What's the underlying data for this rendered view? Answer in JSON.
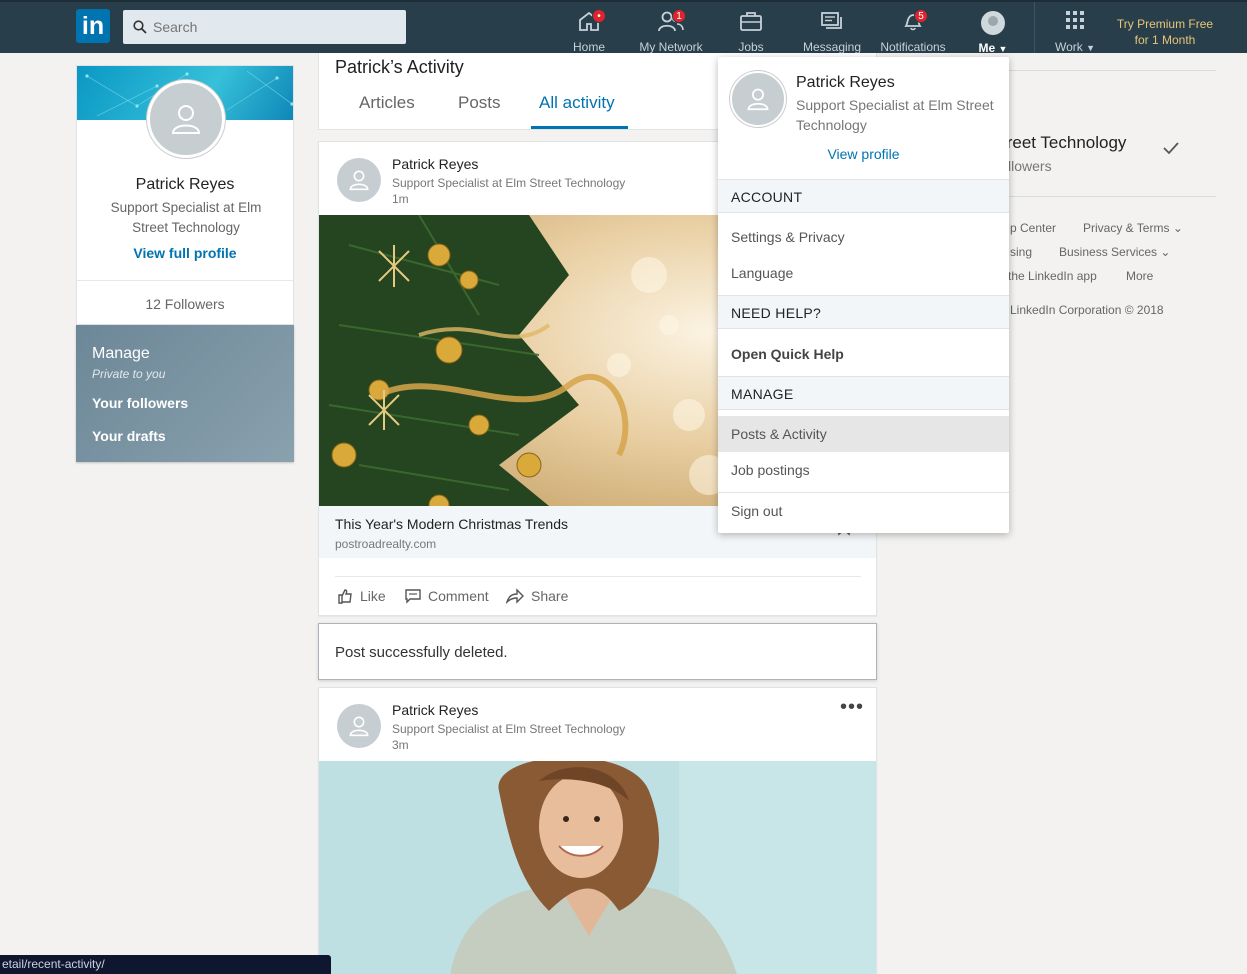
{
  "nav": {
    "logo_text": "in",
    "search_placeholder": "Search",
    "items": [
      {
        "label": "Home",
        "badge": "•"
      },
      {
        "label": "My Network",
        "badge": "1"
      },
      {
        "label": "Jobs",
        "badge": ""
      },
      {
        "label": "Messaging",
        "badge": ""
      },
      {
        "label": "Notifications",
        "badge": "5"
      },
      {
        "label": "Me"
      },
      {
        "label": "Work"
      }
    ],
    "premium_line1": "Try Premium Free",
    "premium_line2": "for 1 Month",
    "accent_color": "#0073b1",
    "bar_color": "#283e4a"
  },
  "profile": {
    "name": "Patrick Reyes",
    "headline": "Support Specialist at Elm Street Technology",
    "view_link": "View full profile",
    "followers": "12 Followers"
  },
  "manage": {
    "title": "Manage",
    "subtitle": "Private to you",
    "links": [
      "Your followers",
      "Your drafts"
    ]
  },
  "activity": {
    "title": "Patrick’s Activity",
    "tabs": [
      "Articles",
      "Posts",
      "All activity"
    ],
    "active_tab": "All activity"
  },
  "posts": [
    {
      "author": "Patrick Reyes",
      "headline": "Support Specialist at Elm Street Technology",
      "time": "1m",
      "link_title": "This Year's Modern Christmas Trends",
      "link_source": "postroadrealty.com",
      "actions": [
        "Like",
        "Comment",
        "Share"
      ]
    },
    {
      "author": "Patrick Reyes",
      "headline": "Support Specialist at Elm Street Technology",
      "time": "3m"
    }
  ],
  "toast": "Post successfully deleted.",
  "right": {
    "company": "treet Technology",
    "followers": "llowers",
    "footer_links": [
      "p Center",
      "Privacy & Terms",
      "sing",
      "Business Services",
      "the LinkedIn app",
      "More"
    ],
    "copyright": "LinkedIn Corporation © 2018"
  },
  "dropdown": {
    "name": "Patrick Reyes",
    "headline": "Support Specialist at Elm Street Technology",
    "view_profile": "View profile",
    "sections": [
      {
        "title": "ACCOUNT",
        "items": [
          "Settings & Privacy",
          "Language"
        ]
      },
      {
        "title": "NEED HELP?",
        "items": [
          "Open Quick Help"
        ]
      },
      {
        "title": "MANAGE",
        "items": [
          "Posts & Activity",
          "Job postings"
        ]
      }
    ],
    "sign_out": "Sign out"
  },
  "status_url": "etail/recent-activity/"
}
